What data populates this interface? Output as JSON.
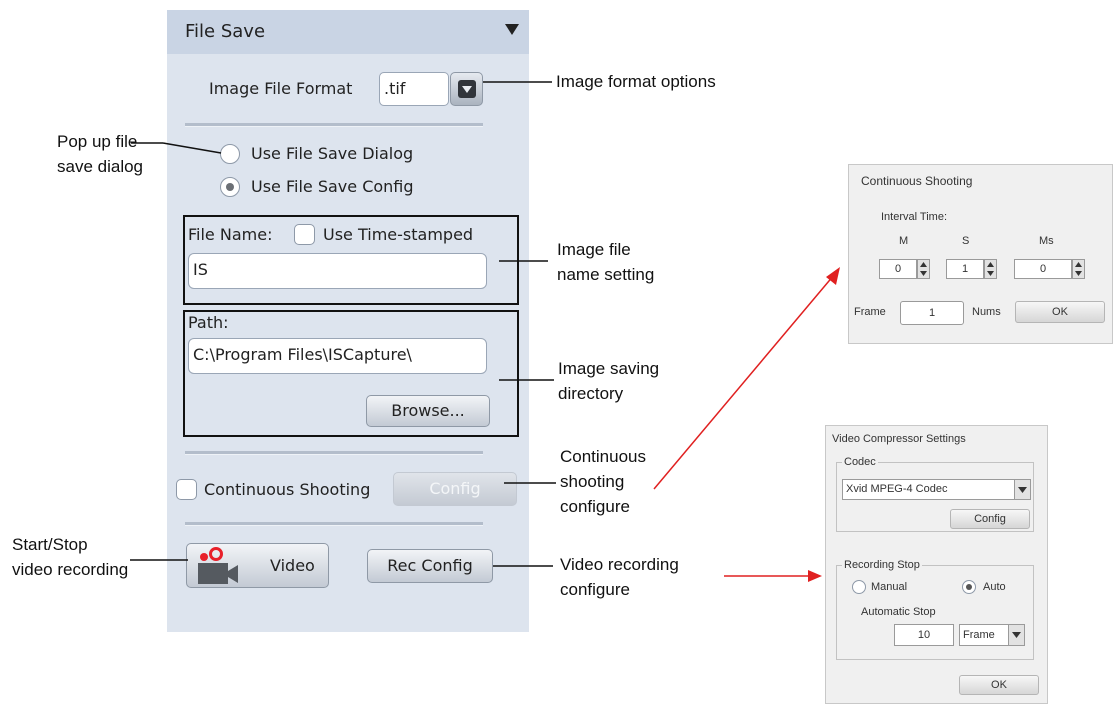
{
  "panel": {
    "title": "File Save",
    "image_format_label": "Image File Format",
    "image_format_value": ".tif",
    "radio_dialog_label": "Use File Save Dialog",
    "radio_config_label": "Use File Save Config",
    "selected_radio": "Use File Save Config",
    "file_name_label": "File Name:",
    "timestamp_label": "Use Time-stamped",
    "file_name_value": "IS",
    "path_label": "Path:",
    "path_value": "C:\\Program Files\\ISCapture\\",
    "browse_label": "Browse...",
    "continuous_label": "Continuous Shooting",
    "config_label": "Config",
    "video_label": "Video",
    "rec_config_label": "Rec Config"
  },
  "annotations": {
    "format_options": "Image format options",
    "popup_line1": "Pop up file",
    "popup_line2": "save dialog",
    "name_line1": "Image file",
    "name_line2": "name setting",
    "dir_line1": "Image saving",
    "dir_line2": "directory",
    "cont_line1": "Continuous",
    "cont_line2": "shooting",
    "cont_line3": "configure",
    "rec_line1": "Video recording",
    "rec_line2": "configure",
    "start_line1": "Start/Stop",
    "start_line2": "video recording"
  },
  "continuous_dialog": {
    "title": "Continuous Shooting",
    "interval_label": "Interval Time:",
    "m_label": "M",
    "s_label": "S",
    "ms_label": "Ms",
    "m_value": "0",
    "s_value": "1",
    "ms_value": "0",
    "frame_label": "Frame",
    "frame_value": "1",
    "nums_label": "Nums",
    "ok_label": "OK"
  },
  "video_dialog": {
    "title": "Video Compressor Settings",
    "codec_group": "Codec",
    "codec_value": "Xvid MPEG-4 Codec",
    "config_label": "Config",
    "recording_stop_group": "Recording Stop",
    "manual_label": "Manual",
    "auto_label": "Auto",
    "selected_mode": "Auto",
    "automatic_stop_label": "Automatic Stop",
    "stop_value": "10",
    "stop_unit": "Frame",
    "ok_label": "OK"
  },
  "colors": {
    "panel_bg": "#dde4ee",
    "header_bg": "#c9d4e4",
    "arrow_red": "#e02020",
    "record_red": "#e8202a"
  },
  "icons": [
    "dropdown-triangle-icon",
    "dropdown-arrow-icon",
    "video-camera-icon",
    "spin-updown-icon"
  ]
}
